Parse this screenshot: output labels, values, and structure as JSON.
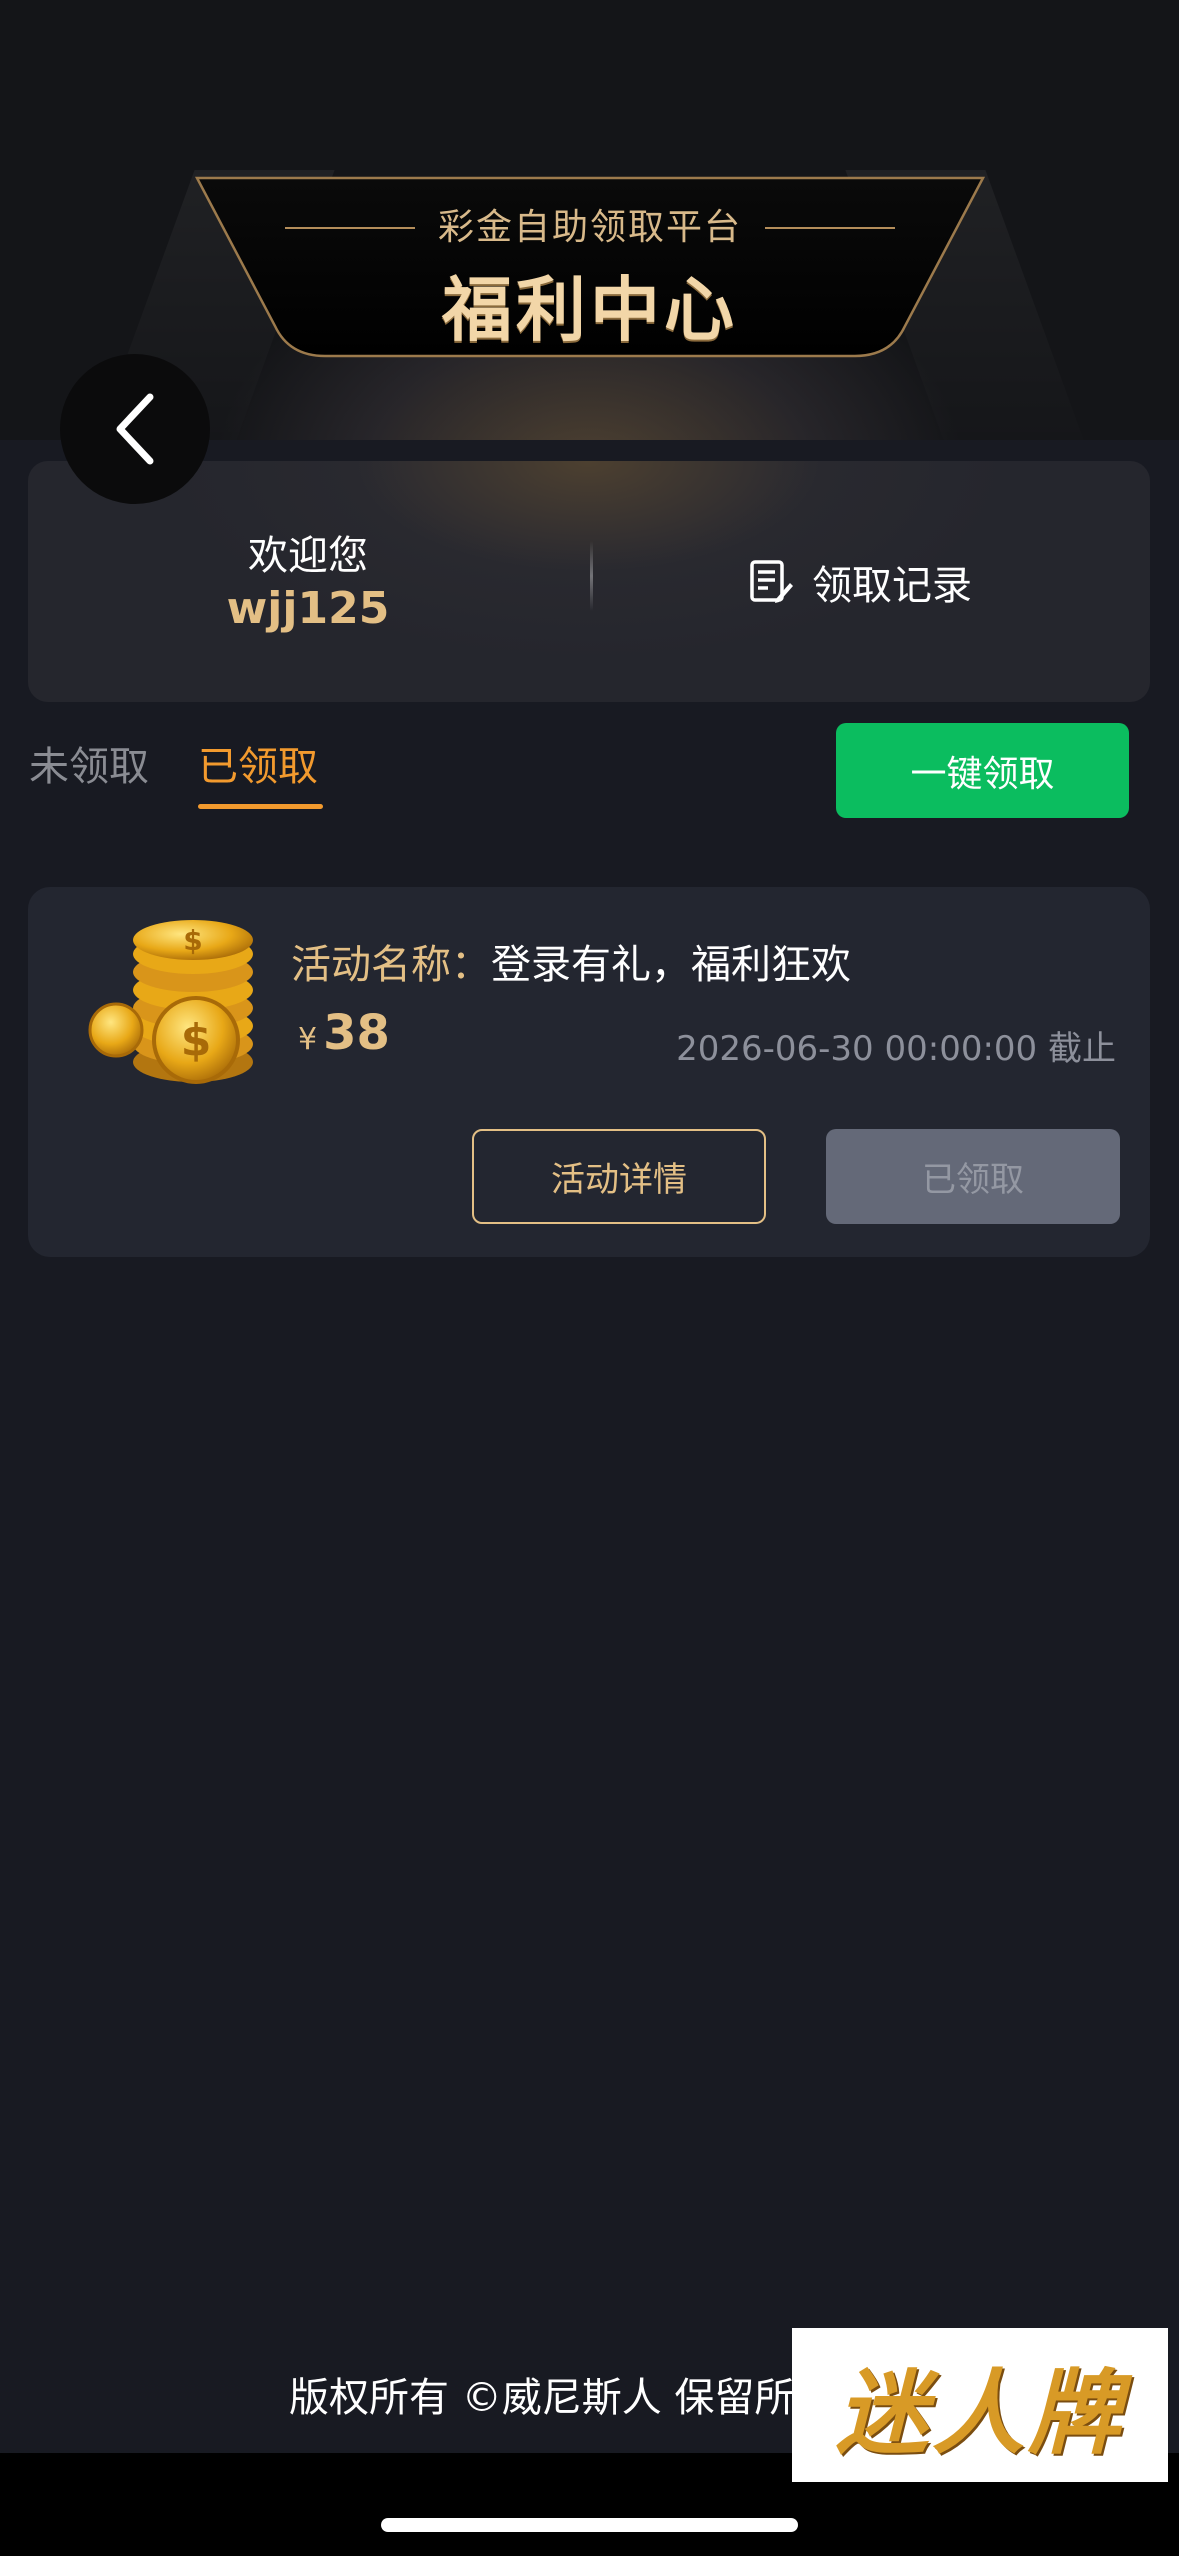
{
  "header": {
    "subtitle": "彩金自助领取平台",
    "title": "福利中心"
  },
  "welcome": {
    "greeting": "欢迎您",
    "username": "wjj125",
    "records_label": "领取记录"
  },
  "tabs": [
    {
      "label": "未领取",
      "active": false
    },
    {
      "label": "已领取",
      "active": true
    }
  ],
  "claim_all_label": "一键领取",
  "activity": {
    "name_label": "活动名称：",
    "name": "登录有礼，福利狂欢",
    "currency": "¥",
    "amount": "38",
    "deadline": "2026-06-30 00:00:00 截止",
    "details_label": "活动详情",
    "status_label": "已领取"
  },
  "footer": {
    "copyright": "版权所有 ©威尼斯人 保留所",
    "watermark": "迷人牌"
  },
  "colors": {
    "accent_gold": "#e3bf85",
    "tab_active": "#f29a2e",
    "claim_green": "#0bbd5f",
    "background": "#181a22"
  },
  "icons": [
    "chevron-left-icon",
    "document-edit-icon",
    "gold-coins-icon"
  ]
}
